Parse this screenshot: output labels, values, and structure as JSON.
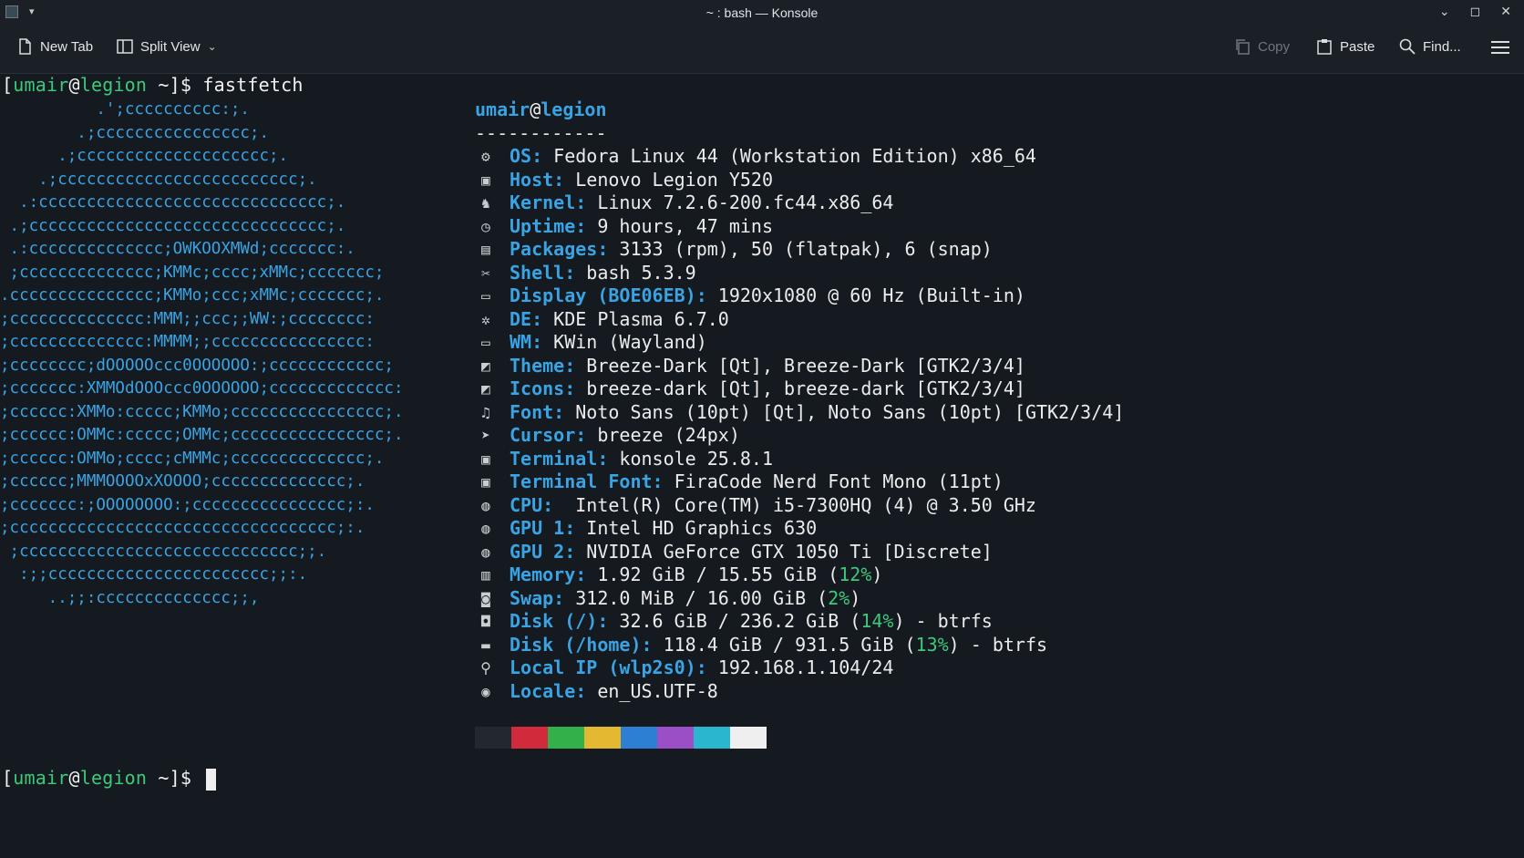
{
  "window": {
    "title": "~ : bash — Konsole",
    "buttons": [
      "minimize-icon",
      "maximize-icon",
      "close-icon"
    ]
  },
  "toolbar": {
    "new_tab": "New Tab",
    "split_view": "Split View",
    "copy": "Copy",
    "paste": "Paste",
    "find": "Find..."
  },
  "prompt": {
    "open": "[",
    "user": "umair",
    "at": "@",
    "host": "legion",
    "rest": " ~]$ ",
    "command": "fastfetch"
  },
  "logo_lines": [
    "          .';cccccccccc:;.",
    "        .;cccccccccccccccc;.",
    "      .;cccccccccccccccccccc;.",
    "    .;ccccccccccccccccccccccccc;.",
    "  .:cccccccccccccccccccccccccccccc;.",
    " .;ccccccccccccccccccccccccccccccc;.",
    " .:cccccccccccccc;OWKOOXMWd;ccccccc:.",
    " ;cccccccccccccc;KMMc;cccc;xMMc;ccccccc;",
    ".ccccccccccccccc;KMMo;ccc;xMMc;ccccccc;.",
    ";cccccccccccccc:MMM;;ccc;;WW:;cccccccc:",
    ";cccccccccccccc:MMMM;;cccccccccccccccc:",
    ";cccccccc;dOOOOOccc0OOOOOO:;cccccccccccc;",
    ";ccccccc:XMMOdOOOccc0OOOOOO;ccccccccccccc:",
    ";cccccc:XMMo:ccccc;KMMo;cccccccccccccccc;.",
    ";cccccc:OMMc:ccccc;OMMc;cccccccccccccccc;.",
    ";cccccc:OMMo;cccc;cMMMc;cccccccccccccc;.",
    ";cccccc;MMMOOOOxXOOOO;cccccccccccccc;.",
    ";ccccccc:;OOOOOOOO:;cccccccccccccccc;:.",
    ";cccccccccccccccccccccccccccccccccc;:.",
    " ;ccccccccccccccccccccccccccccc;;.",
    "  :;;ccccccccccccccccccccccc;;:.",
    "     ..;;:cccccccccccccc;;,"
  ],
  "info": {
    "user": "umair",
    "at": "@",
    "host": "legion",
    "separator": "------------",
    "rows": [
      {
        "icon": "fedora-icon",
        "glyph": "⚙",
        "key": "OS:",
        "value": " Fedora Linux 44 (Workstation Edition) x86_64"
      },
      {
        "icon": "host-icon",
        "glyph": "▣",
        "key": "Host:",
        "value": " Lenovo Legion Y520"
      },
      {
        "icon": "kernel-icon",
        "glyph": "♞",
        "key": "Kernel:",
        "value": " Linux 7.2.6-200.fc44.x86_64"
      },
      {
        "icon": "uptime-icon",
        "glyph": "◷",
        "key": "Uptime:",
        "value": " 9 hours, 47 mins"
      },
      {
        "icon": "packages-icon",
        "glyph": "▤",
        "key": "Packages:",
        "value": " 3133 (rpm), 50 (flatpak), 6 (snap)"
      },
      {
        "icon": "shell-icon",
        "glyph": "✂",
        "key": "Shell:",
        "value": " bash 5.3.9"
      },
      {
        "icon": "display-icon",
        "glyph": "▭",
        "key": "Display (BOE06EB):",
        "value": " 1920x1080 @ 60 Hz (Built-in)"
      },
      {
        "icon": "de-icon",
        "glyph": "✲",
        "key": "DE:",
        "value": " KDE Plasma 6.7.0"
      },
      {
        "icon": "wm-icon",
        "glyph": "▭",
        "key": "WM:",
        "value": " KWin (Wayland)"
      },
      {
        "icon": "theme-icon",
        "glyph": "◩",
        "key": "Theme:",
        "value": " Breeze-Dark [Qt], Breeze-Dark [GTK2/3/4]"
      },
      {
        "icon": "icons-icon",
        "glyph": "◩",
        "key": "Icons:",
        "value": " breeze-dark [Qt], breeze-dark [GTK2/3/4]"
      },
      {
        "icon": "font-icon",
        "glyph": "♫",
        "key": "Font:",
        "value": " Noto Sans (10pt) [Qt], Noto Sans (10pt) [GTK2/3/4]"
      },
      {
        "icon": "cursor-icon",
        "glyph": "➤",
        "key": "Cursor:",
        "value": " breeze (24px)"
      },
      {
        "icon": "terminal-icon",
        "glyph": "▣",
        "key": "Terminal:",
        "value": " konsole 25.8.1"
      },
      {
        "icon": "terminal-font-icon",
        "glyph": "▣",
        "key": "Terminal Font:",
        "value": " FiraCode Nerd Font Mono (11pt)"
      },
      {
        "icon": "cpu-icon",
        "glyph": "◍",
        "key": "CPU:",
        "value": "  Intel(R) Core(TM) i5-7300HQ (4) @ 3.50 GHz"
      },
      {
        "icon": "gpu-icon",
        "glyph": "◍",
        "key": "GPU 1:",
        "value": " Intel HD Graphics 630"
      },
      {
        "icon": "gpu-icon",
        "glyph": "◍",
        "key": "GPU 2:",
        "value": " NVIDIA GeForce GTX 1050 Ti [Discrete]"
      },
      {
        "icon": "memory-icon",
        "glyph": "▥",
        "key": "Memory:",
        "value": " 1.92 GiB / 15.55 GiB (",
        "pct": "12%",
        "after": ")"
      },
      {
        "icon": "swap-icon",
        "glyph": "◙",
        "key": "Swap:",
        "value": " 312.0 MiB / 16.00 GiB (",
        "pct": "2%",
        "after": ")"
      },
      {
        "icon": "disk-icon",
        "glyph": "◘",
        "key": "Disk (/):",
        "value": " 32.6 GiB / 236.2 GiB (",
        "pct": "14%",
        "after": ") - btrfs"
      },
      {
        "icon": "disk-icon",
        "glyph": "▬",
        "key": "Disk (/home):",
        "value": " 118.4 GiB / 931.5 GiB (",
        "pct": "13%",
        "after": ") - btrfs"
      },
      {
        "icon": "network-icon",
        "glyph": "⚲",
        "key": "Local IP (wlp2s0):",
        "value": " 192.168.1.104/24"
      },
      {
        "icon": "locale-icon",
        "glyph": "◉",
        "key": "Locale:",
        "value": " en_US.UTF-8"
      }
    ]
  },
  "palette": [
    "#23272e",
    "#d12a3b",
    "#33b04a",
    "#e5b832",
    "#2d7fd3",
    "#9a4fc6",
    "#2ab6cf",
    "#efefef"
  ],
  "prompt2": {
    "open": "[",
    "user": "umair",
    "at": "@",
    "host": "legion",
    "rest": " ~]$ "
  }
}
